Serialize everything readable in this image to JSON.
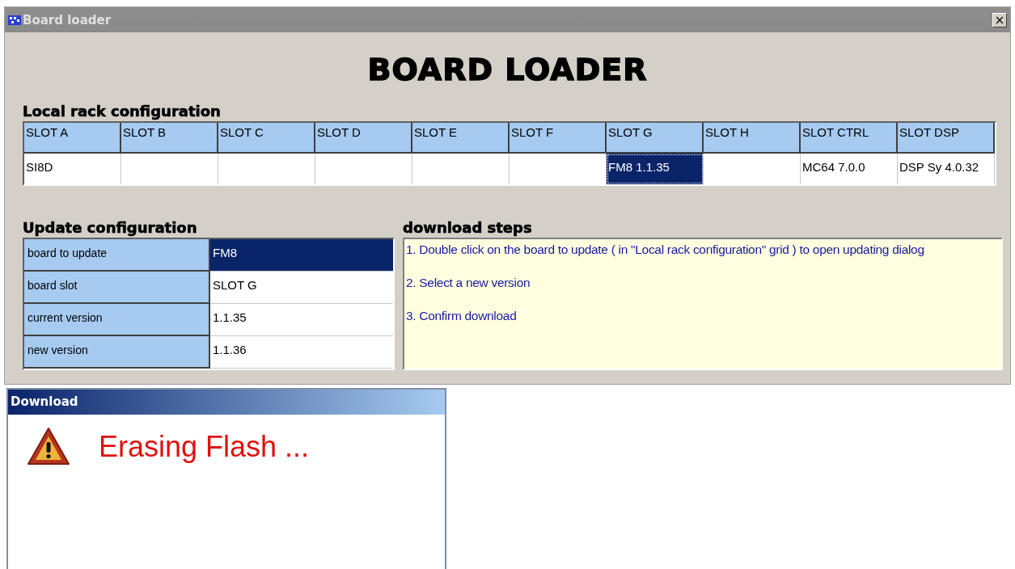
{
  "window": {
    "title": "Board loader",
    "close": "×"
  },
  "heading": "BOARD LOADER",
  "rack": {
    "title": "Local rack configuration",
    "slots": [
      {
        "header": "SLOT A",
        "value": "SI8D",
        "selected": false
      },
      {
        "header": "SLOT B",
        "selected": false
      },
      {
        "header": "SLOT C",
        "selected": false
      },
      {
        "header": "SLOT D",
        "selected": false
      },
      {
        "header": "SLOT E",
        "selected": false
      },
      {
        "header": "SLOT F",
        "selected": false
      },
      {
        "header": "SLOT G",
        "value": "FM8 1.1.35",
        "selected": true
      },
      {
        "header": "SLOT H",
        "selected": false
      },
      {
        "header": "SLOT CTRL",
        "value": "MC64 7.0.0",
        "selected": false
      },
      {
        "header": "SLOT DSP",
        "value": "DSP Sy 4.0.32",
        "selected": false
      }
    ]
  },
  "update": {
    "title": "Update configuration",
    "rows": [
      {
        "label": "board to update",
        "value": "FM8",
        "selected": true
      },
      {
        "label": "board slot",
        "value": "SLOT G",
        "selected": false
      },
      {
        "label": "current version",
        "value": "1.1.35",
        "selected": false
      },
      {
        "label": "new version",
        "value": "1.1.36",
        "selected": false
      }
    ]
  },
  "steps": {
    "title": "download steps",
    "items": [
      "1. Double click on the board to update ( in \"Local rack configuration\" grid ) to open updating dialog",
      "2. Select a new version",
      "3. Confirm download"
    ]
  },
  "dialog": {
    "title": "Download",
    "message": "Erasing Flash ..."
  }
}
